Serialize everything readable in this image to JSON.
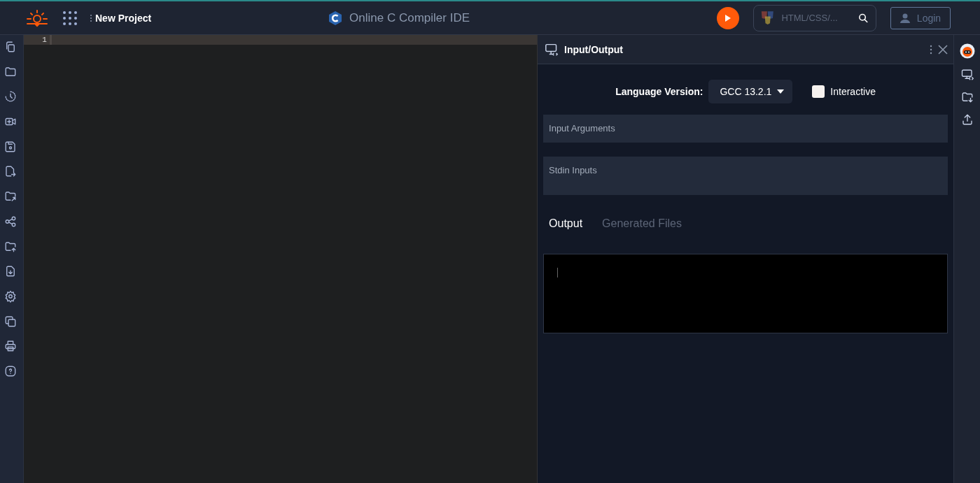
{
  "header": {
    "project_name": "New Project",
    "title": "Online C Compiler IDE",
    "search_placeholder": "HTML/CSS/...",
    "login": "Login"
  },
  "editor": {
    "line_numbers": [
      "1"
    ]
  },
  "io_panel": {
    "title": "Input/Output",
    "language_label": "Language Version:",
    "language_version": "GCC 13.2.1",
    "interactive": {
      "label": "Interactive",
      "checked": false
    },
    "fields": [
      {
        "placeholder": "Input Arguments",
        "kind": "single"
      },
      {
        "placeholder": "Stdin Inputs",
        "kind": "multi"
      }
    ],
    "output_tabs": [
      {
        "label": "Output",
        "selected": true
      },
      {
        "label": "Generated Files",
        "selected": false
      }
    ]
  }
}
